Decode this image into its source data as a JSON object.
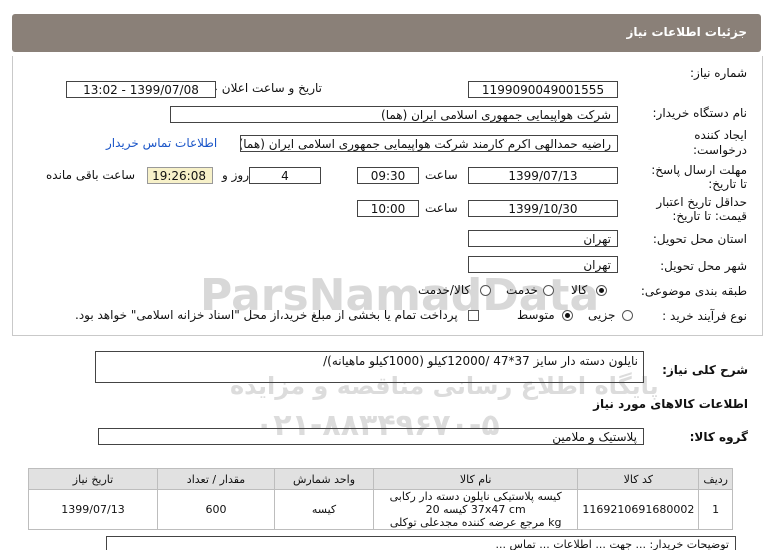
{
  "header": {
    "title": "جزئیات اطلاعات نیاز"
  },
  "fields": {
    "need_number_label": "شماره نیاز:",
    "need_number": "1199090049001555",
    "announce_label": "تاریخ و ساعت اعلان عمومی:",
    "announce_value": "1399/07/08 - 13:02",
    "buyer_label": "نام دستگاه خریدار:",
    "buyer_value": "شرکت هواپیمایی جمهوری اسلامی ایران (هما)",
    "creator_label_1": "ایجاد کننده",
    "creator_label_2": "درخواست:",
    "creator_value": "راضیه حمدالهی اکرم کارمند شرکت هواپیمایی جمهوری اسلامی ایران (هما)",
    "contact_link": "اطلاعات تماس خریدار",
    "deadline_label_1": "مهلت ارسال پاسخ:",
    "deadline_label_2": "تا تاریخ:",
    "deadline_date": "1399/07/13",
    "time_label": "ساعت",
    "deadline_time": "09:30",
    "days_value": "4",
    "days_label": "روز و",
    "remaining_time": "19:26:08",
    "remaining_label": "ساعت باقی مانده",
    "validity_label_1": "حداقل تاریخ اعتبار",
    "validity_label_2": "قیمت: تا تاریخ:",
    "validity_date": "1399/10/30",
    "validity_time_label": "ساعت",
    "validity_time": "10:00",
    "province_label": "استان محل تحویل:",
    "province_value": "تهران",
    "city_label": "شهر محل تحویل:",
    "city_value": "تهران",
    "category_label": "طبقه بندی موضوعی:",
    "category_options": [
      "کالا",
      "خدمت",
      "کالا/خدمت"
    ],
    "process_label": "نوع فرآیند خرید :",
    "process_options": [
      "جزیی",
      "متوسط"
    ],
    "payment_note": "پرداخت تمام یا بخشی از مبلغ خرید،از محل \"اسناد خزانه اسلامی\" خواهد بود."
  },
  "watermark": {
    "brand": "ParsNamadData",
    "tagline": "پایگاه اطلاع رسانی مناقصه و مزایده",
    "phone": "۰۲۱-۸۸۳۴۹۶۷۰-۵"
  },
  "description": {
    "label": "شرح کلی نیاز:",
    "value": "نایلون دسته دار سایز 37*47  /12000کیلو (1000کیلو ماهیانه)/"
  },
  "goods": {
    "section_title": "اطلاعات کالاهای مورد نیاز",
    "group_label": "گروه کالا:",
    "group_value": "پلاستیک و ملامین"
  },
  "table": {
    "headers": [
      "ردیف",
      "کد کالا",
      "نام کالا",
      "واحد شمارش",
      "مقدار / تعداد",
      "تاریخ نیاز"
    ],
    "rows": [
      {
        "row": "1",
        "code": "1169210691680002",
        "name_1": "کیسه پلاستیکی نایلون دسته دار رکابی 37x47 cm کیسه 20",
        "name_2": "kg مرجع عرضه کننده مجدعلی توکلی",
        "unit": "کیسه",
        "qty": "600",
        "date": "1399/07/13"
      }
    ]
  },
  "footer_partial": "توضیحات خریدار: ... جهت ... اطلاعات ... تماس ..."
}
